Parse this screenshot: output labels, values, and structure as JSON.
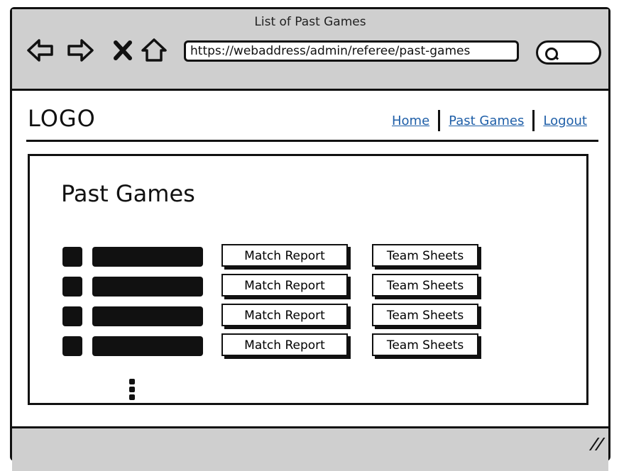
{
  "window": {
    "title": "List of Past Games",
    "url": "https://webaddress/admin/referee/past-games"
  },
  "icons": [
    "back-icon",
    "forward-icon",
    "close-icon",
    "home-icon",
    "search-icon",
    "resize-grip-icon"
  ],
  "header": {
    "logo": "LOGO",
    "nav": [
      {
        "label": "Home"
      },
      {
        "label": "Past Games"
      },
      {
        "label": "Logout"
      }
    ]
  },
  "main": {
    "title": "Past Games",
    "games": [
      {
        "report_label": "Match Report",
        "sheets_label": "Team Sheets"
      },
      {
        "report_label": "Match Report",
        "sheets_label": "Team Sheets"
      },
      {
        "report_label": "Match Report",
        "sheets_label": "Team Sheets"
      },
      {
        "report_label": "Match Report",
        "sheets_label": "Team Sheets"
      }
    ]
  },
  "colors": {
    "chrome": "#cfcfcf",
    "link": "#1f5fa8",
    "ink": "#111111"
  }
}
